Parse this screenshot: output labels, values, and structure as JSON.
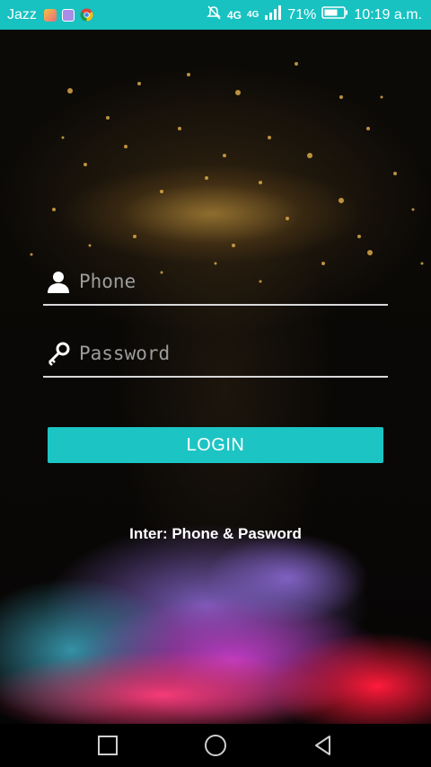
{
  "status_bar": {
    "carrier": "Jazz",
    "network_label": "4G",
    "battery_percent": "71%",
    "time": "10:19 a.m.",
    "accent_color": "#17c2c1",
    "icons": [
      "photos-icon",
      "gallery-icon",
      "chrome-icon",
      "mute-icon",
      "signal-icon",
      "battery-icon"
    ]
  },
  "login_form": {
    "phone": {
      "placeholder": "Phone",
      "value": ""
    },
    "password": {
      "placeholder": "Password",
      "value": ""
    },
    "login_label": "LOGIN",
    "hint_text": "Inter: Phone & Pasword",
    "button_color": "#1dc4c4"
  },
  "nav_bar": {
    "buttons": [
      "recents-square-icon",
      "home-circle-icon",
      "back-triangle-icon"
    ]
  }
}
